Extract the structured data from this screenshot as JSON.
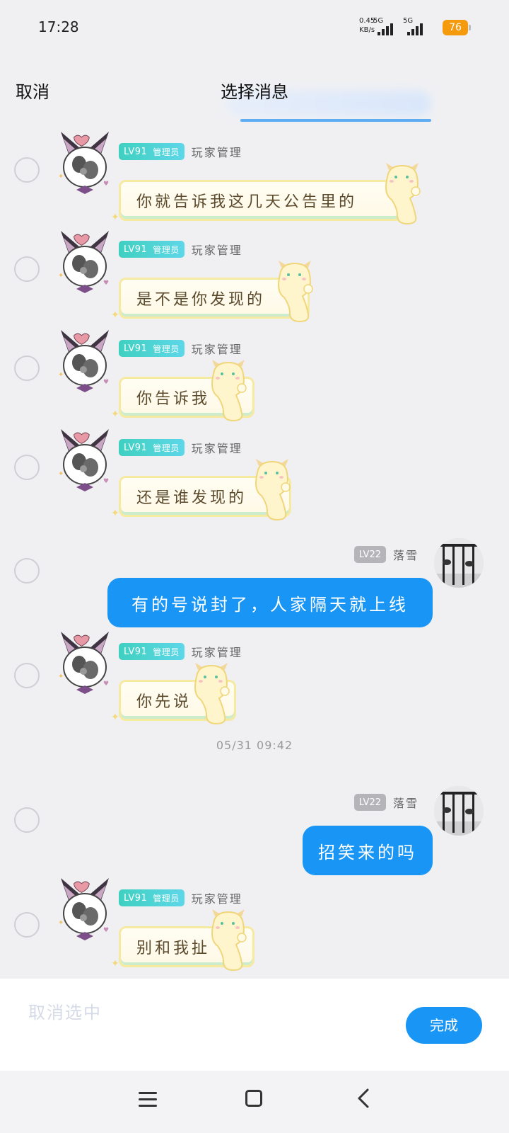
{
  "status_bar": {
    "time": "17:28",
    "net_speed_value": "0.45",
    "net_speed_unit": "KB/s",
    "sim1_label": "5G",
    "sim2_label": "5G",
    "battery": "76",
    "battery_color": "#f59a0c"
  },
  "header": {
    "cancel_label": "取消",
    "title": "选择消息"
  },
  "messages": [
    {
      "side": "left",
      "level": "LV91",
      "role": "管理员",
      "name": "玩家管理",
      "text": "你就告诉我这几天公告里的"
    },
    {
      "side": "left",
      "level": "LV91",
      "role": "管理员",
      "name": "玩家管理",
      "text": "是不是你发现的"
    },
    {
      "side": "left",
      "level": "LV91",
      "role": "管理员",
      "name": "玩家管理",
      "text": "你告诉我"
    },
    {
      "side": "left",
      "level": "LV91",
      "role": "管理员",
      "name": "玩家管理",
      "text": "还是谁发现的"
    },
    {
      "side": "right",
      "level": "LV22",
      "name": "落雪",
      "text": "有的号说封了，人家隔天就上线"
    },
    {
      "side": "left",
      "level": "LV91",
      "role": "管理员",
      "name": "玩家管理",
      "text": "你先说"
    },
    {
      "side": "right",
      "level": "LV22",
      "name": "落雪",
      "text": "招笑来的吗"
    },
    {
      "side": "left",
      "level": "LV91",
      "role": "管理员",
      "name": "玩家管理",
      "text": "别和我扯"
    }
  ],
  "timestamp": "05/31 09:42",
  "action_bar": {
    "unselect_label": "取消选中",
    "done_label": "完成"
  },
  "colors": {
    "accent_blue": "#1996f5",
    "admin_badge": "#3fd0c0",
    "user_badge": "#b5b5b9"
  },
  "nav_icons": [
    "menu-icon",
    "home-icon",
    "back-icon"
  ]
}
